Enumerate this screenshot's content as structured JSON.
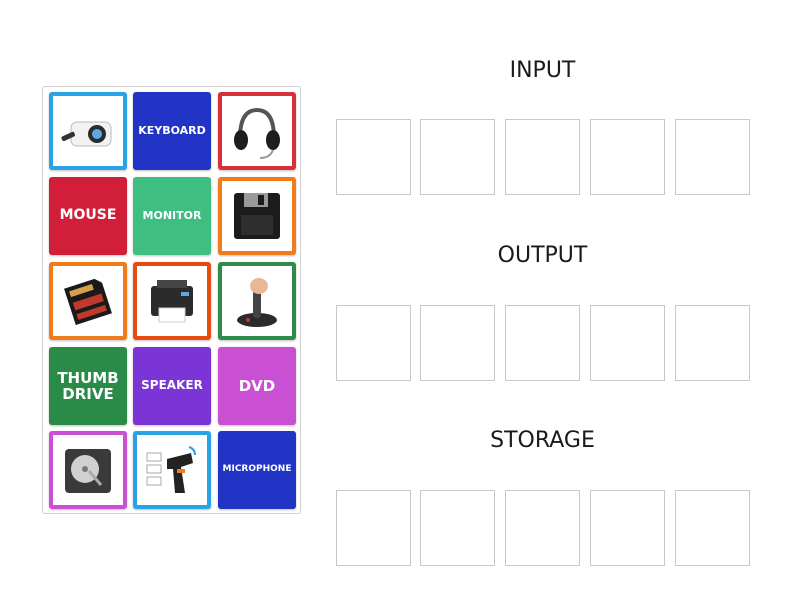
{
  "tiles": [
    {
      "type": "image",
      "name": "projector",
      "border": "#2aa2e6"
    },
    {
      "type": "text",
      "label": "KEYBOARD",
      "bg": "#2134c6"
    },
    {
      "type": "image",
      "name": "headphones",
      "border": "#d8303a"
    },
    {
      "type": "text",
      "label": "MOUSE",
      "bg": "#d11f3a"
    },
    {
      "type": "text",
      "label": "MONITOR",
      "bg": "#3fbe82"
    },
    {
      "type": "image",
      "name": "floppy-disk",
      "border": "#f07b19"
    },
    {
      "type": "image",
      "name": "sd-card",
      "border": "#f07b19"
    },
    {
      "type": "image",
      "name": "printer",
      "border": "#e84a10"
    },
    {
      "type": "image",
      "name": "joystick",
      "border": "#2e8b4a"
    },
    {
      "type": "text",
      "label": "THUMB DRIVE",
      "bg": "#2a8a47"
    },
    {
      "type": "text",
      "label": "SPEAKER",
      "bg": "#7b35d6"
    },
    {
      "type": "text",
      "label": "DVD",
      "bg": "#c94fd3"
    },
    {
      "type": "image",
      "name": "hard-drive",
      "border": "#c94fd3"
    },
    {
      "type": "image",
      "name": "barcode-scanner",
      "border": "#2aa2e6"
    },
    {
      "type": "text",
      "label": "MICROPHONE",
      "bg": "#2134c6"
    }
  ],
  "categories": [
    {
      "title": "INPUT",
      "slots": 5
    },
    {
      "title": "OUTPUT",
      "slots": 5
    },
    {
      "title": "STORAGE",
      "slots": 5
    }
  ]
}
